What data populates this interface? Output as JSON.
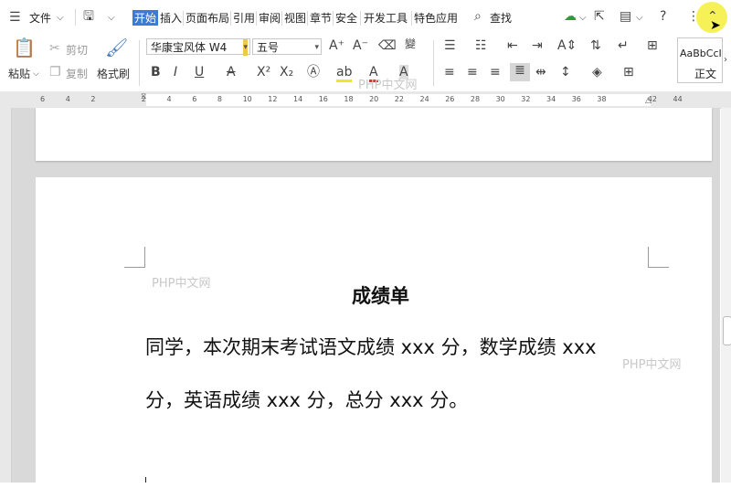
{
  "menubar": {
    "file_label": "文件",
    "tabs": [
      "开始",
      "插入",
      "页面布局",
      "引用",
      "审阅",
      "视图",
      "章节",
      "安全",
      "开发工具",
      "特色应用"
    ],
    "search_label": "查找"
  },
  "ribbon": {
    "paste_label": "粘贴",
    "cut_label": "剪切",
    "copy_label": "复制",
    "format_painter_label": "格式刷",
    "font_name": "华康宝风体 W4",
    "font_size": "五号",
    "style_preview": "AaBbCcI",
    "style_name": "正文"
  },
  "ruler": {
    "numbers": [
      "6",
      "4",
      "2",
      "",
      "2",
      "4",
      "6",
      "8",
      "10",
      "12",
      "14",
      "16",
      "18",
      "20",
      "22",
      "24",
      "26",
      "28",
      "30",
      "32",
      "34",
      "36",
      "38",
      "",
      "42",
      "44"
    ]
  },
  "document": {
    "title": "成绩单",
    "line1": "同学，本次期末考试语文成绩 xxx 分，数学成绩 xxx",
    "line2": "分，英语成绩 xxx 分，总分 xxx 分。"
  },
  "watermarks": [
    "PHP中文网",
    "PHP中文网",
    "PHP中文网"
  ]
}
